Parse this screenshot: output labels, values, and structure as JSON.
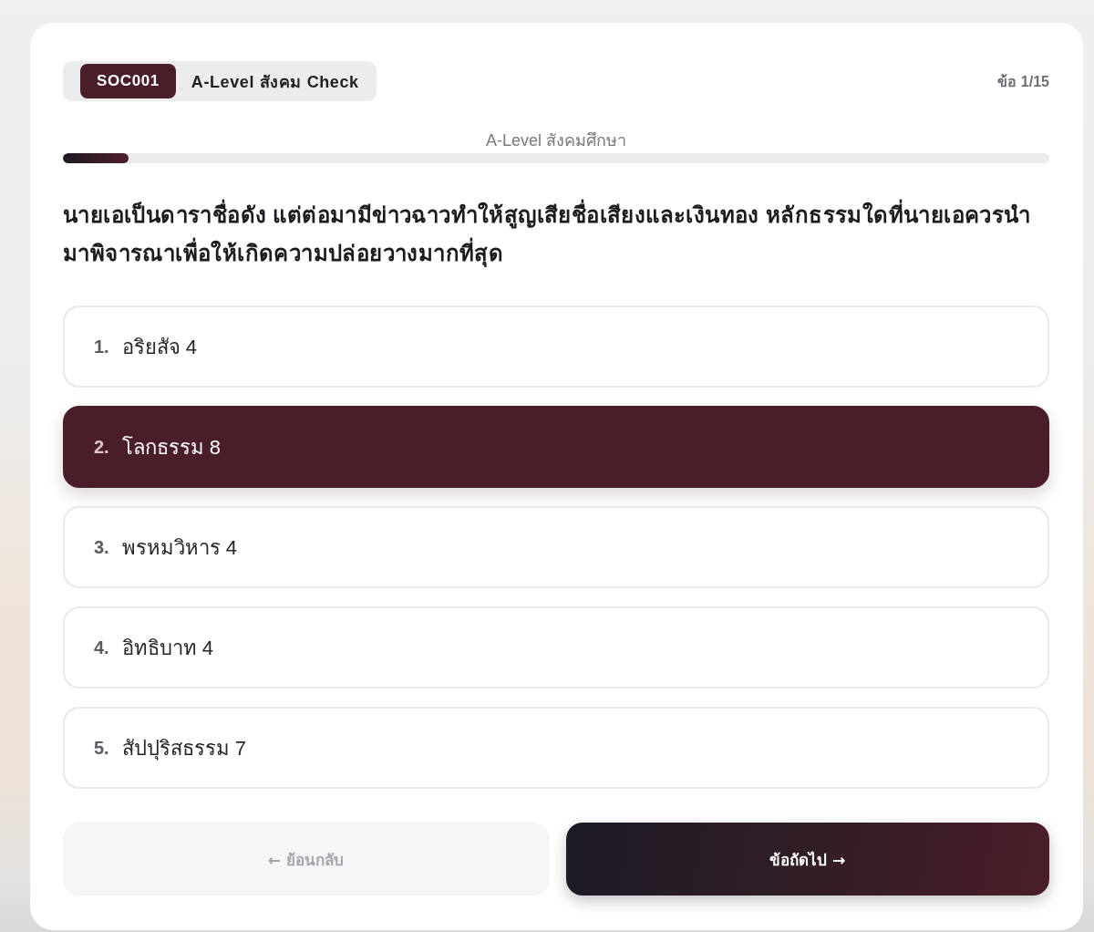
{
  "header": {
    "code": "SOC001",
    "title": "A-Level สังคม Check",
    "counter": "ข้อ 1/15"
  },
  "subject": "A-Level สังคมศึกษา",
  "progress": {
    "level": 0.0667
  },
  "question": "นายเอเป็นดาราชื่อดัง แต่ต่อมามีข่าวฉาวทำให้สูญเสียชื่อเสียงและเงินทอง หลักธรรมใดที่นายเอควรนำมาพิจารณาเพื่อให้เกิดความปล่อยวางมากที่สุด",
  "options": [
    {
      "number": "1.",
      "label": "อริยสัจ 4",
      "selected": false
    },
    {
      "number": "2.",
      "label": "โลกธรรม 8",
      "selected": true
    },
    {
      "number": "3.",
      "label": "พรหมวิหาร 4",
      "selected": false
    },
    {
      "number": "4.",
      "label": "อิทธิบาท 4",
      "selected": false
    },
    {
      "number": "5.",
      "label": "สัปปุริสธรรม 7",
      "selected": false
    }
  ],
  "buttons": [
    {
      "kind": "back",
      "label": "← ย้อนกลับ",
      "disabled": true
    },
    {
      "kind": "next",
      "label": "ข้อถัดไป →",
      "disabled": false
    }
  ]
}
